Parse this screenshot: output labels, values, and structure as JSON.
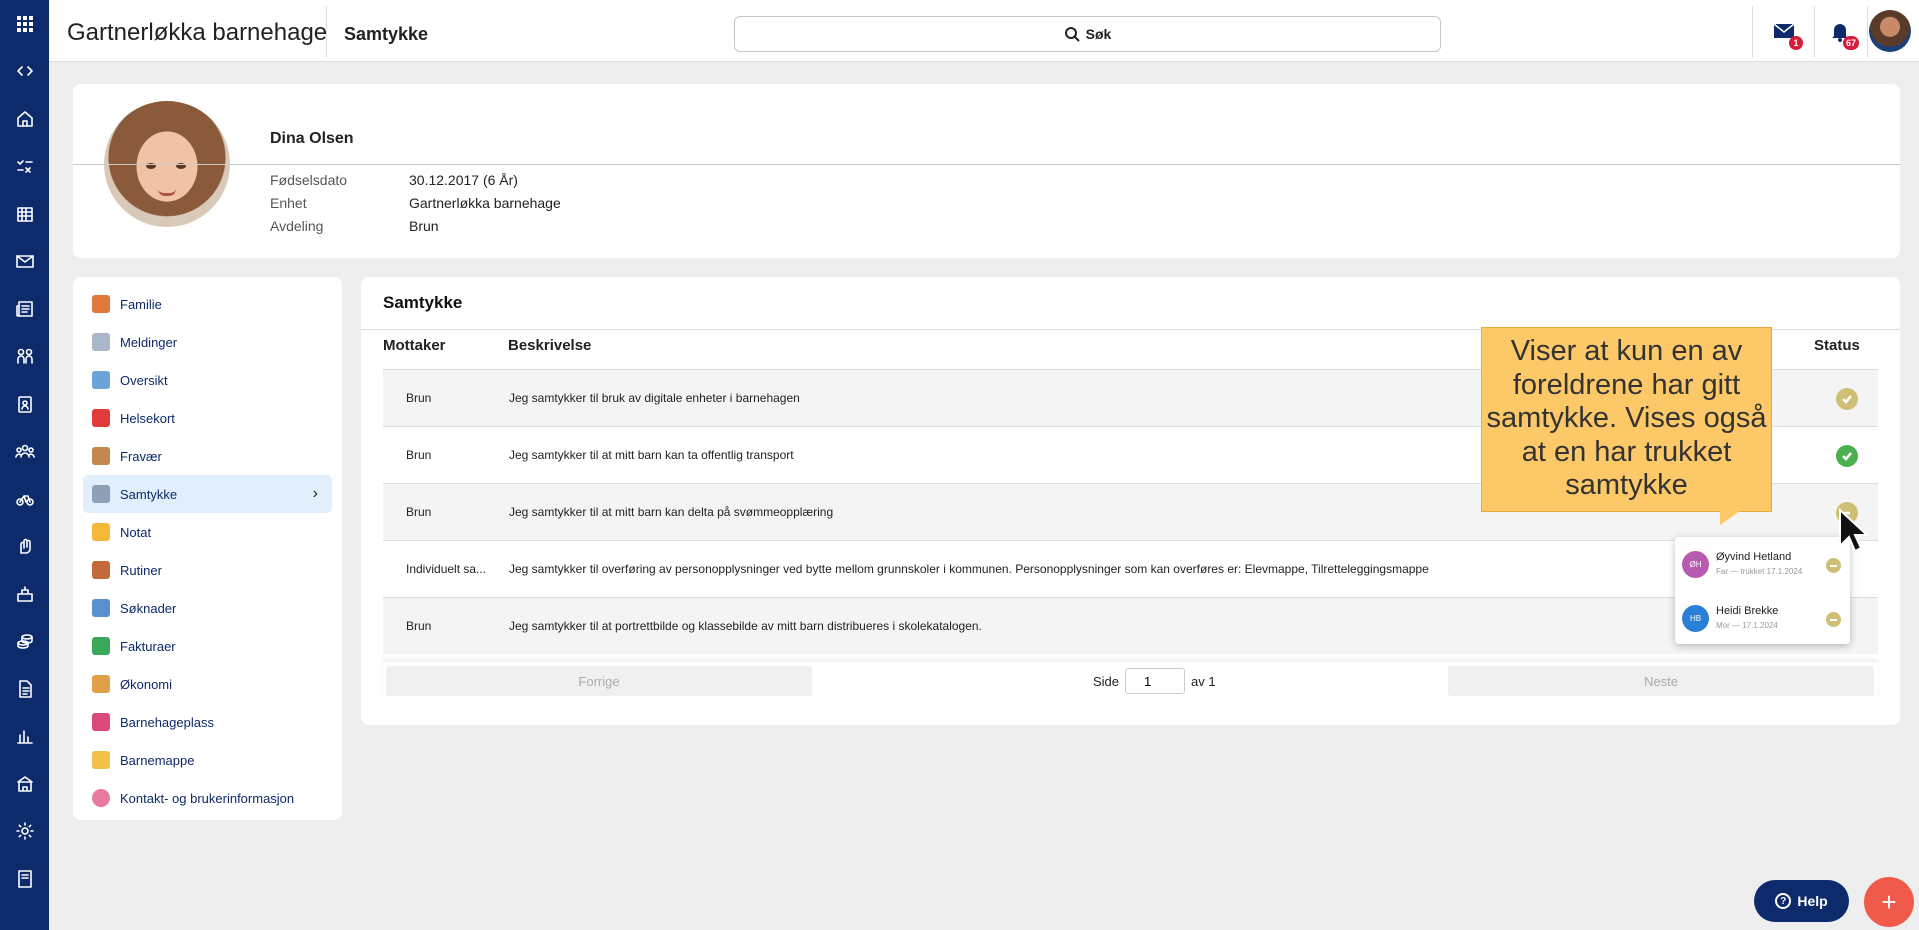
{
  "header": {
    "app_title": "Gartnerløkka barnehage",
    "page_title": "Samtykke",
    "search_label": "Søk",
    "mail_badge": "1",
    "notif_badge": "67"
  },
  "rail": {
    "icons": [
      "apps-grid-icon",
      "expand-code-icon",
      "home-icon",
      "tasks-icon",
      "calendar-icon",
      "mail-icon",
      "news-icon",
      "groups-icon",
      "badge-icon",
      "people-icon",
      "bike-icon",
      "hand-icon",
      "school-icon",
      "coins-icon",
      "document-icon",
      "chart-icon",
      "building-icon",
      "settings-icon",
      "book-icon"
    ]
  },
  "profile": {
    "name": "Dina Olsen",
    "fields": [
      {
        "label": "Fødselsdato",
        "value": "30.12.2017 (6 År)"
      },
      {
        "label": "Enhet",
        "value": "Gartnerløkka barnehage"
      },
      {
        "label": "Avdeling",
        "value": "Brun"
      }
    ]
  },
  "menu": {
    "items": [
      {
        "label": "Familie",
        "color": "#e07a3a"
      },
      {
        "label": "Meldinger",
        "color": "#a9b7c9"
      },
      {
        "label": "Oversikt",
        "color": "#6aa4d8"
      },
      {
        "label": "Helsekort",
        "color": "#e23b3b"
      },
      {
        "label": "Fravær",
        "color": "#c4874e"
      },
      {
        "label": "Samtykke",
        "color": "#8da0b8",
        "active": true
      },
      {
        "label": "Notat",
        "color": "#f5b93a"
      },
      {
        "label": "Rutiner",
        "color": "#c46a3a"
      },
      {
        "label": "Søknader",
        "color": "#5a8fd0"
      },
      {
        "label": "Fakturaer",
        "color": "#3aa85a"
      },
      {
        "label": "Økonomi",
        "color": "#e0a04a"
      },
      {
        "label": "Barnehageplass",
        "color": "#d94a7a"
      },
      {
        "label": "Barnemappe",
        "color": "#f2c14a"
      },
      {
        "label": "Kontakt- og brukerinformasjon",
        "color": "#e87aa0"
      }
    ]
  },
  "consent": {
    "title": "Samtykke",
    "columns": {
      "recipient": "Mottaker",
      "description": "Beskrivelse",
      "status": "Status"
    },
    "rows": [
      {
        "recipient": "Brun",
        "description": "Jeg samtykker til bruk av digitale enheter i barnehagen",
        "status": "partial",
        "status_color": "#cdbf73"
      },
      {
        "recipient": "Brun",
        "description": "Jeg samtykker til at mitt barn kan ta offentlig transport",
        "status": "approved",
        "status_color": "#4caf50"
      },
      {
        "recipient": "Brun",
        "description": "Jeg samtykker til at mitt barn kan delta på svømmeopplæring",
        "status": "partial",
        "status_color": "#cdbf73"
      },
      {
        "recipient": "Individuelt sa...",
        "description": "Jeg samtykker til overføring av personopplysninger ved bytte mellom grunnskoler i kommunen. Personopplysninger som kan overføres er: Elevmappe, Tilretteleggingsmappe",
        "status": "none",
        "status_color": ""
      },
      {
        "recipient": "Brun",
        "description": "Jeg samtykker til at portrettbilde og klassebilde av mitt barn distribueres i skolekatalogen.",
        "status": "none",
        "status_color": ""
      }
    ],
    "pager": {
      "prev": "Forrige",
      "next": "Neste",
      "page_label": "Side",
      "page": "1",
      "of_label": "av 1"
    }
  },
  "popover": {
    "entries": [
      {
        "initials": "ØH",
        "name": "Øyvind Hetland",
        "sub": "Far  —  trukket 17.1.2024",
        "color": "#b85ab0"
      },
      {
        "initials": "HB",
        "name": "Heidi Brekke",
        "sub": "Mor  —  17.1.2024",
        "color": "#2a7fd6"
      }
    ]
  },
  "callout": {
    "text": "Viser at kun en av foreldrene har gitt samtykke. Vises også at en har trukket samtykke"
  },
  "help": {
    "label": "Help"
  },
  "fab": {
    "label": "+"
  }
}
